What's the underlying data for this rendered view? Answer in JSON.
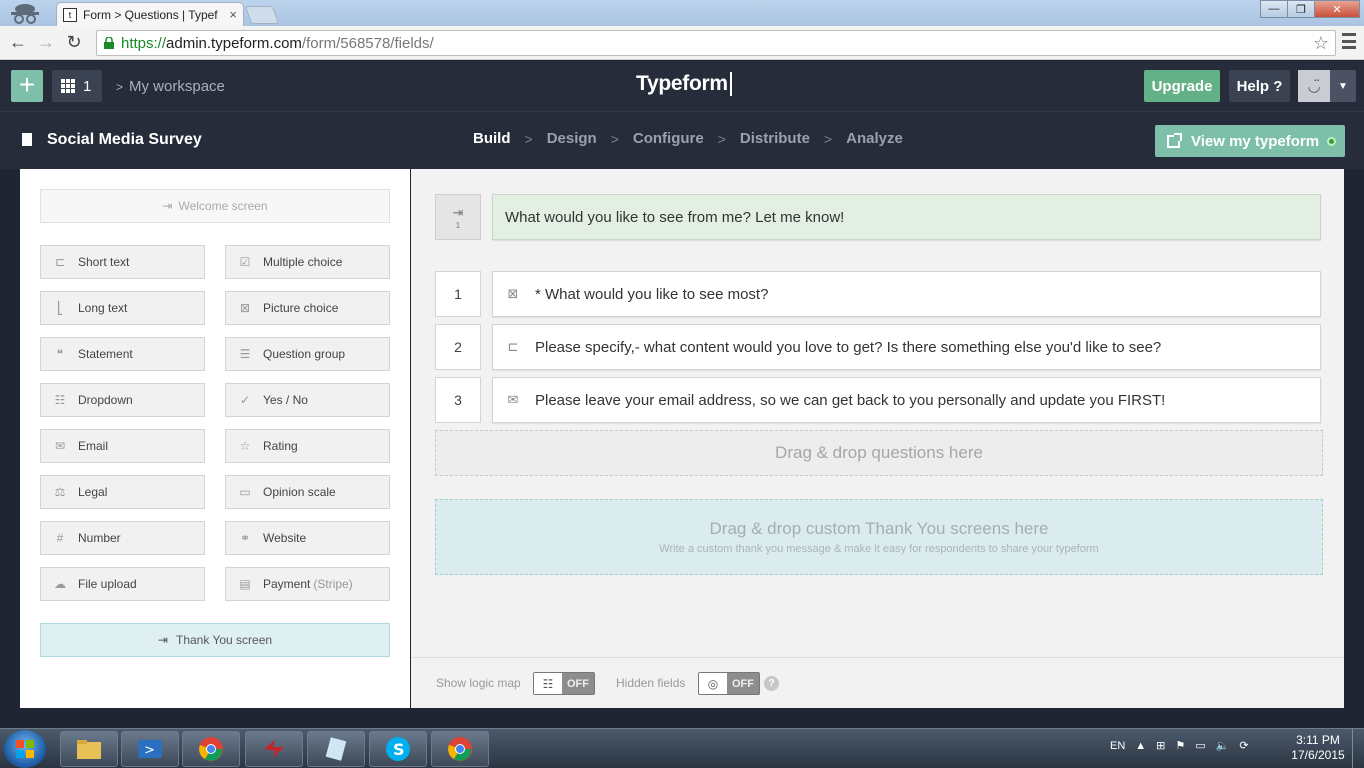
{
  "browser": {
    "tab_favicon": "t",
    "tab_title": "Form > Questions | Typef",
    "url_protocol": "https://",
    "url_host": "admin.typeform.com",
    "url_path": "/form/568578/fields/"
  },
  "header": {
    "app_count": "1",
    "workspace": "My workspace",
    "brand": "Typeform",
    "upgrade": "Upgrade",
    "help": "Help ?"
  },
  "formbar": {
    "title": "Social Media Survey",
    "steps": [
      "Build",
      "Design",
      "Configure",
      "Distribute",
      "Analyze"
    ],
    "view_button": "View my typeform"
  },
  "sidebar": {
    "welcome": "Welcome screen",
    "types": [
      {
        "label": "Short text",
        "icon": "short-text-icon"
      },
      {
        "label": "Multiple choice",
        "icon": "multiple-choice-icon"
      },
      {
        "label": "Long text",
        "icon": "long-text-icon"
      },
      {
        "label": "Picture choice",
        "icon": "picture-choice-icon"
      },
      {
        "label": "Statement",
        "icon": "statement-icon"
      },
      {
        "label": "Question group",
        "icon": "question-group-icon"
      },
      {
        "label": "Dropdown",
        "icon": "dropdown-icon"
      },
      {
        "label": "Yes / No",
        "icon": "yes-no-icon"
      },
      {
        "label": "Email",
        "icon": "email-icon"
      },
      {
        "label": "Rating",
        "icon": "rating-icon"
      },
      {
        "label": "Legal",
        "icon": "legal-icon"
      },
      {
        "label": "Opinion scale",
        "icon": "opinion-scale-icon"
      },
      {
        "label": "Number",
        "icon": "number-icon"
      },
      {
        "label": "Website",
        "icon": "website-icon"
      },
      {
        "label": "File upload",
        "icon": "file-upload-icon"
      },
      {
        "label": "Payment",
        "icon": "payment-icon"
      }
    ],
    "payment_suffix": "(Stripe)",
    "thankyou": "Thank You screen"
  },
  "main": {
    "welcome_num": "1",
    "welcome_text": "What would you like to see from me? Let me know!",
    "questions": [
      {
        "num": "1",
        "text": "* What would you like to see most?",
        "icon": "picture-choice-icon"
      },
      {
        "num": "2",
        "text": "Please specify,- what content would you love to get? Is there something else you'd like to see?",
        "icon": "short-text-icon"
      },
      {
        "num": "3",
        "text": "Please leave your email address, so we can get back to you personally and update you FIRST!",
        "icon": "email-icon"
      }
    ],
    "drop_questions": "Drag & drop questions here",
    "drop_thankyou_title": "Drag & drop custom Thank You screens here",
    "drop_thankyou_sub": "Write a custom thank you message & make it easy for respondents to share your typeform"
  },
  "bottombar": {
    "logic_label": "Show logic map",
    "logic_state": "OFF",
    "hidden_label": "Hidden fields",
    "hidden_state": "OFF",
    "help": "?"
  },
  "taskbar": {
    "lang": "EN",
    "time": "3:11 PM",
    "date": "17/6/2015"
  },
  "colors": {
    "accent_green": "#64b087",
    "accent_teal": "#7dbfa8",
    "header_bg": "#262c39"
  }
}
